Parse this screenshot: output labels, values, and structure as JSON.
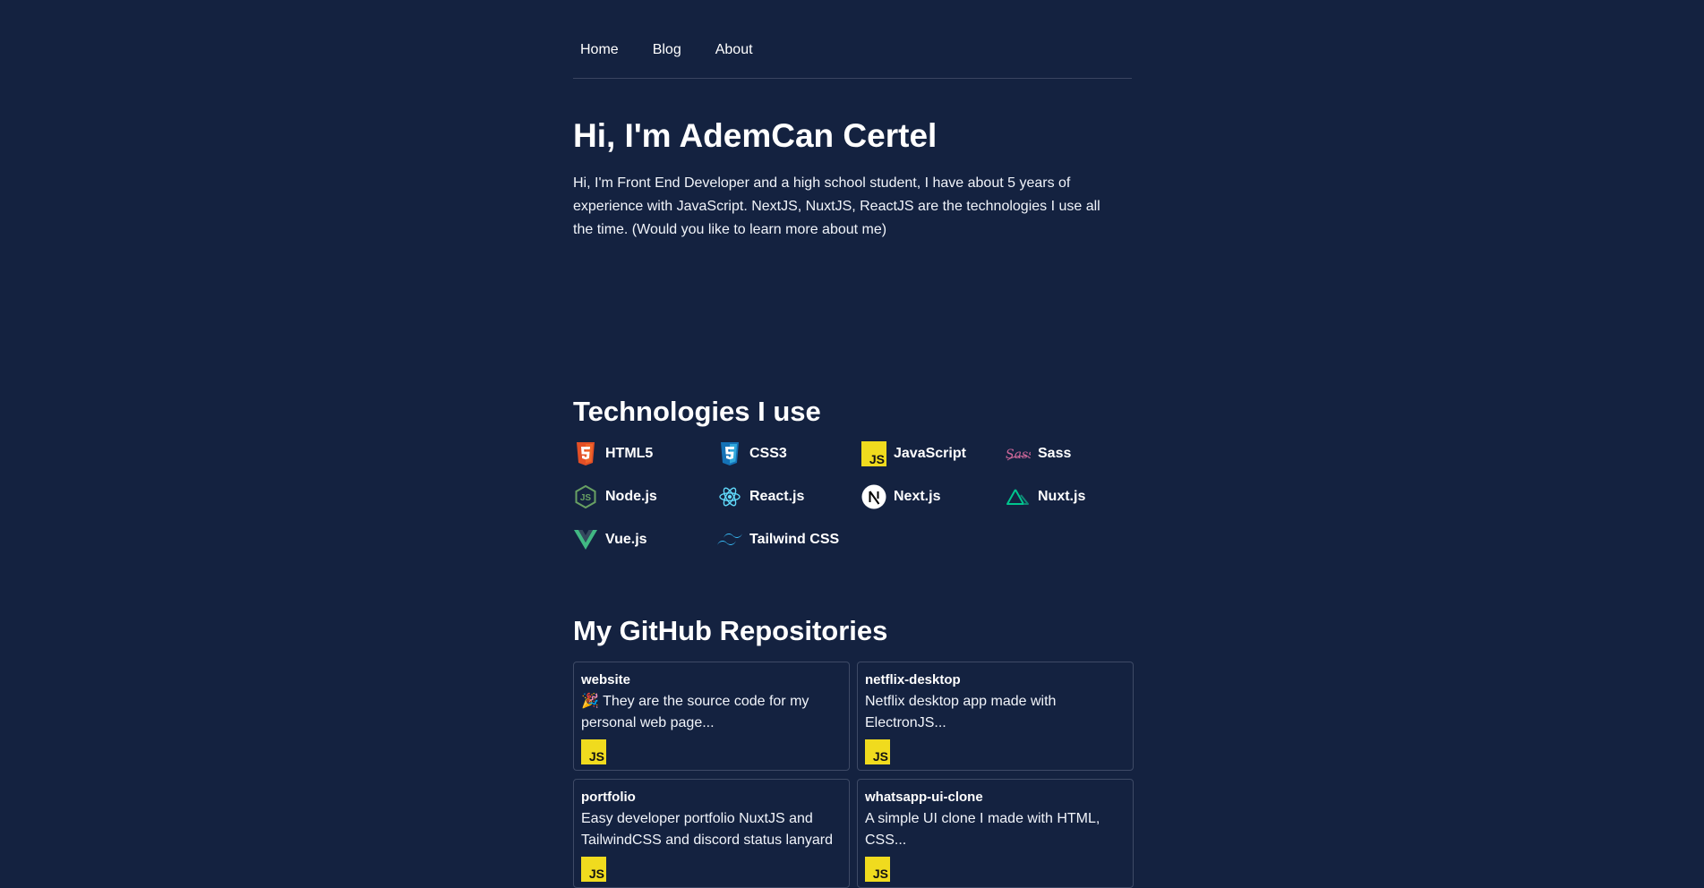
{
  "nav": {
    "links": [
      {
        "label": "Home"
      },
      {
        "label": "Blog"
      },
      {
        "label": "About"
      }
    ]
  },
  "hero": {
    "title": "Hi, I'm AdemCan Certel",
    "description": "Hi, I'm Front End Developer and a high school student, I have about 5 years of experience with JavaScript. NextJS, NuxtJS, ReactJS are the technologies I use all the time. (Would you like to learn more about me)"
  },
  "technologies": {
    "title": "Technologies I use",
    "items": [
      {
        "label": "HTML5",
        "icon": "html5-icon",
        "color": "#e34f26"
      },
      {
        "label": "CSS3",
        "icon": "css3-icon",
        "color": "#1572b6"
      },
      {
        "label": "JavaScript",
        "icon": "javascript-icon",
        "color": "#f0db1e"
      },
      {
        "label": "Sass",
        "icon": "sass-icon",
        "color": "#cd6799"
      },
      {
        "label": "Node.js",
        "icon": "nodejs-icon",
        "color": "#68a063"
      },
      {
        "label": "React.js",
        "icon": "react-icon",
        "color": "#61dafb"
      },
      {
        "label": "Next.js",
        "icon": "nextjs-icon",
        "color": "#ffffff"
      },
      {
        "label": "Nuxt.js",
        "icon": "nuxtjs-icon",
        "color": "#00c58e"
      },
      {
        "label": "Vue.js",
        "icon": "vuejs-icon",
        "color": "#41b883"
      },
      {
        "label": "Tailwind CSS",
        "icon": "tailwind-icon",
        "color": "#38bdf8"
      }
    ]
  },
  "repositories": {
    "title": "My GitHub Repositories",
    "items": [
      {
        "name": "website",
        "description": "🎉 They are the source code for my personal web page...",
        "language": "JS"
      },
      {
        "name": "netflix-desktop",
        "description": "Netflix desktop app made with ElectronJS...",
        "language": "JS"
      },
      {
        "name": "portfolio",
        "description": "Easy developer portfolio NuxtJS and TailwindCSS and discord status lanyard",
        "language": "JS"
      },
      {
        "name": "whatsapp-ui-clone",
        "description": "A simple UI clone I made with HTML, CSS...",
        "language": "JS"
      }
    ]
  },
  "colors": {
    "background": "#142240",
    "text": "#ffffff",
    "border": "#3e4a66"
  }
}
